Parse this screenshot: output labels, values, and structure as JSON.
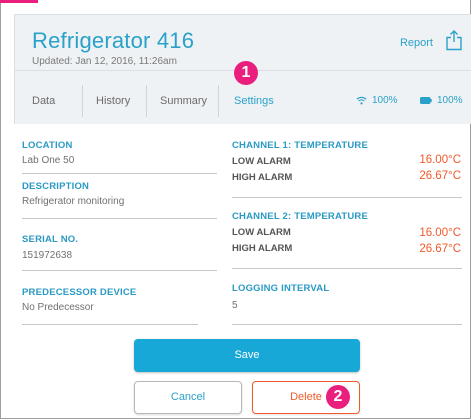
{
  "header": {
    "title": "Refrigerator 416",
    "updated": "Updated: Jan 12, 2016, 11:26am",
    "report_label": "Report",
    "share_icon": "share-icon"
  },
  "tabs": [
    {
      "label": "Data"
    },
    {
      "label": "History"
    },
    {
      "label": "Summary"
    },
    {
      "label": "Settings",
      "active": true
    }
  ],
  "status": {
    "wifi_icon": "wifi-icon",
    "wifi_value": "100%",
    "battery_icon": "battery-icon",
    "battery_value": "100%"
  },
  "markers": {
    "one": "1",
    "two": "2"
  },
  "fields": {
    "location": {
      "label": "LOCATION",
      "value": "Lab One 50"
    },
    "description": {
      "label": "DESCRIPTION",
      "value": "Refrigerator monitoring"
    },
    "serial": {
      "label": "SERIAL NO.",
      "value": "151972638"
    },
    "predecessor": {
      "label": "PREDECESSOR DEVICE",
      "value": "No Predecessor"
    },
    "logging": {
      "label": "LOGGING INTERVAL",
      "value": "5"
    }
  },
  "channels": [
    {
      "label": "CHANNEL 1: TEMPERATURE",
      "low_label": "LOW ALARM",
      "low_value": "16.00°C",
      "high_label": "HIGH ALARM",
      "high_value": "26.67°C"
    },
    {
      "label": "CHANNEL 2: TEMPERATURE",
      "low_label": "LOW ALARM",
      "low_value": "16.00°C",
      "high_label": "HIGH ALARM",
      "high_value": "26.67°C"
    }
  ],
  "buttons": {
    "save": "Save",
    "cancel": "Cancel",
    "delete": "Delete"
  },
  "colors": {
    "accent": "#2aa1c9",
    "alarm": "#f05a2a",
    "marker": "#e91e7d",
    "save_bg": "#17a8d7"
  }
}
